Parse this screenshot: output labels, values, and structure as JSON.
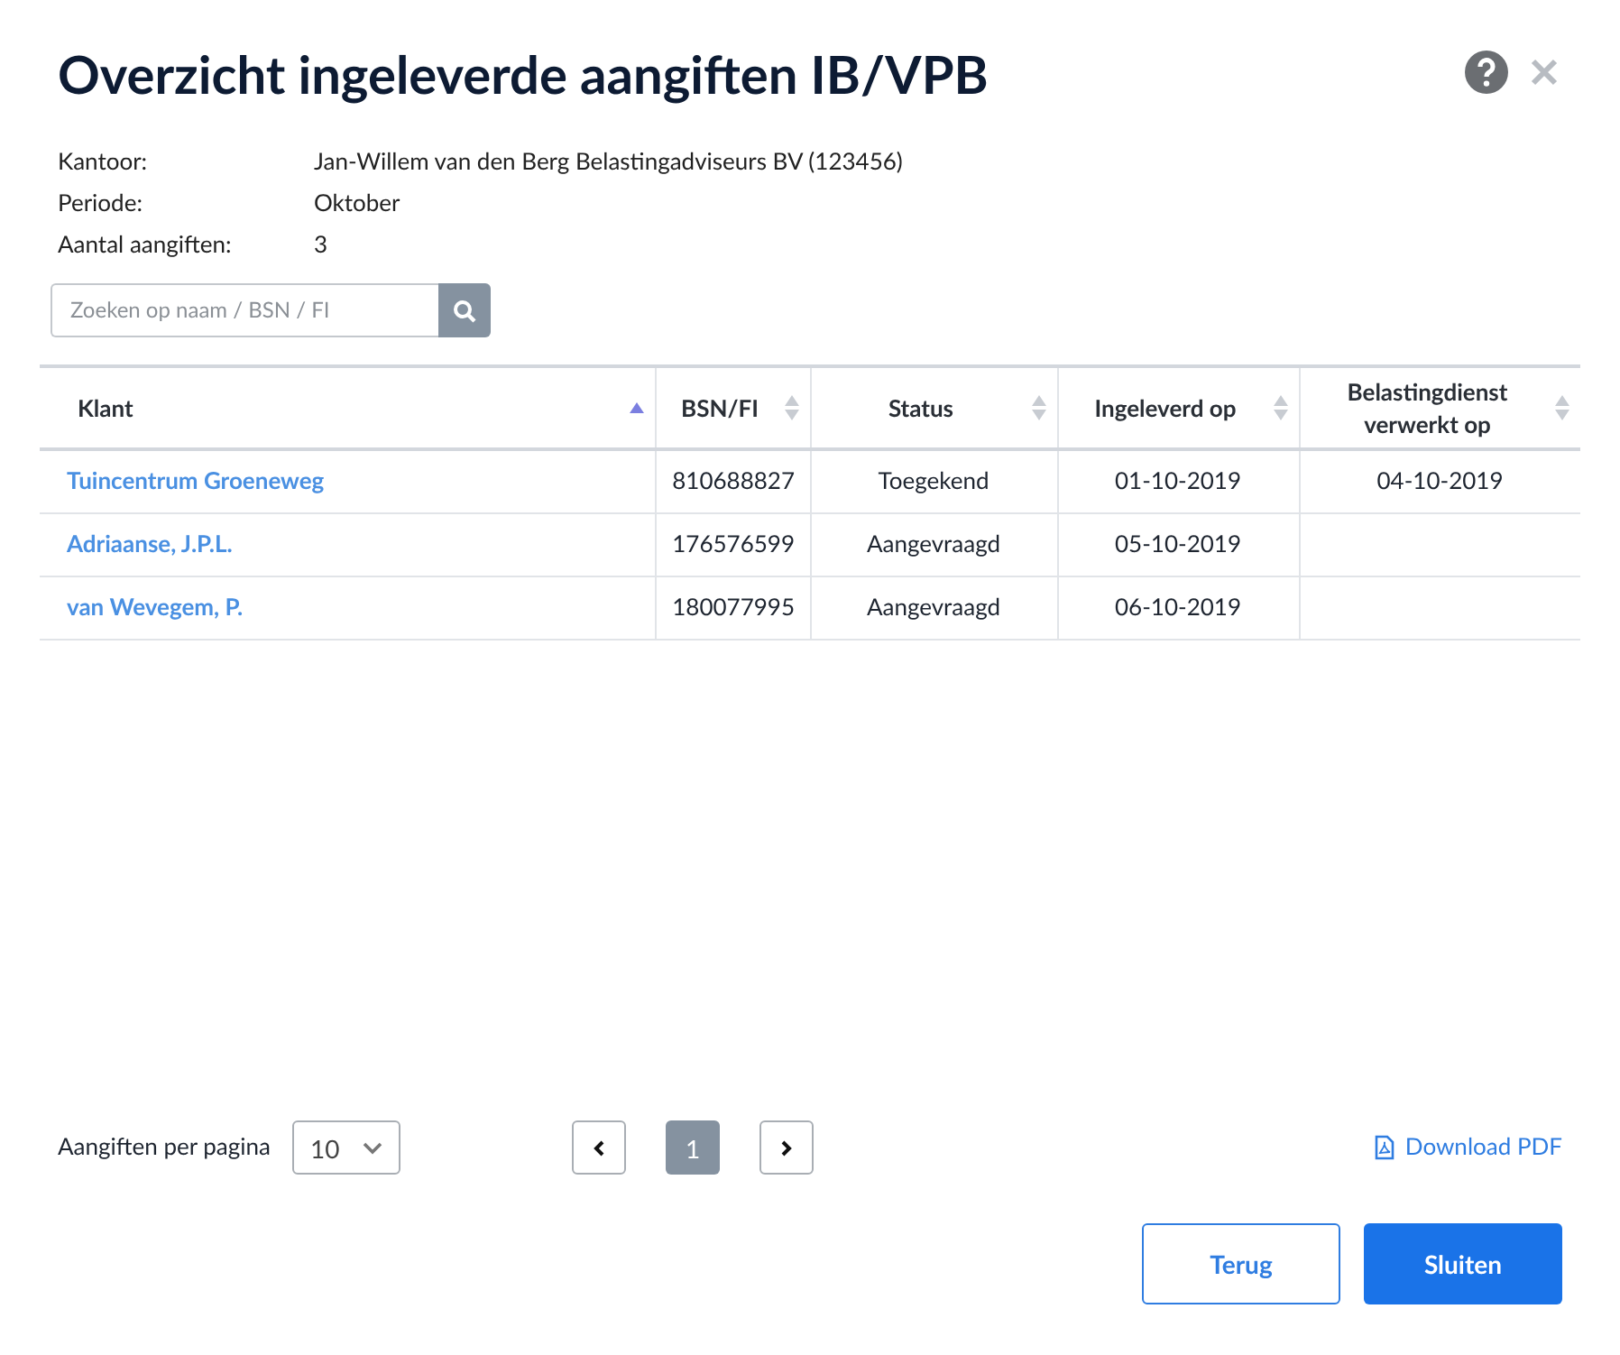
{
  "title": "Overzicht ingeleverde aangiften IB/VPB",
  "info": [
    {
      "label": "Kantoor:",
      "value": "Jan-Willem van den Berg Belastingadviseurs BV (123456)"
    },
    {
      "label": "Periode:",
      "value": "Oktober"
    },
    {
      "label": "Aantal aangiften:",
      "value": "3"
    }
  ],
  "search": {
    "placeholder": "Zoeken op naam / BSN / FI"
  },
  "table": {
    "columns": [
      {
        "label": "Klant",
        "sorted": true
      },
      {
        "label": "BSN/FI",
        "sorted": false
      },
      {
        "label": "Status",
        "sorted": false
      },
      {
        "label": "Ingeleverd op",
        "sorted": false
      },
      {
        "label": "Belastingdienst verwerkt op",
        "sorted": false
      }
    ],
    "rows": [
      [
        "Tuincentrum Groeneweg",
        "810688827",
        "Toegekend",
        "01-10-2019",
        "04-10-2019"
      ],
      [
        "Adriaanse, J.P.L.",
        "176576599",
        "Aangevraagd",
        "05-10-2019",
        ""
      ],
      [
        "van Wevegem, P.",
        "180077995",
        "Aangevraagd",
        "06-10-2019",
        ""
      ]
    ]
  },
  "per_page": {
    "label": "Aangiften per pagina",
    "value": "10"
  },
  "pages": [
    {
      "label": "1",
      "selected": true
    }
  ],
  "download": "Download PDF",
  "buttons": [
    {
      "label": "Terug",
      "kind": "secondary"
    },
    {
      "label": "Sluiten",
      "kind": "primary"
    }
  ]
}
